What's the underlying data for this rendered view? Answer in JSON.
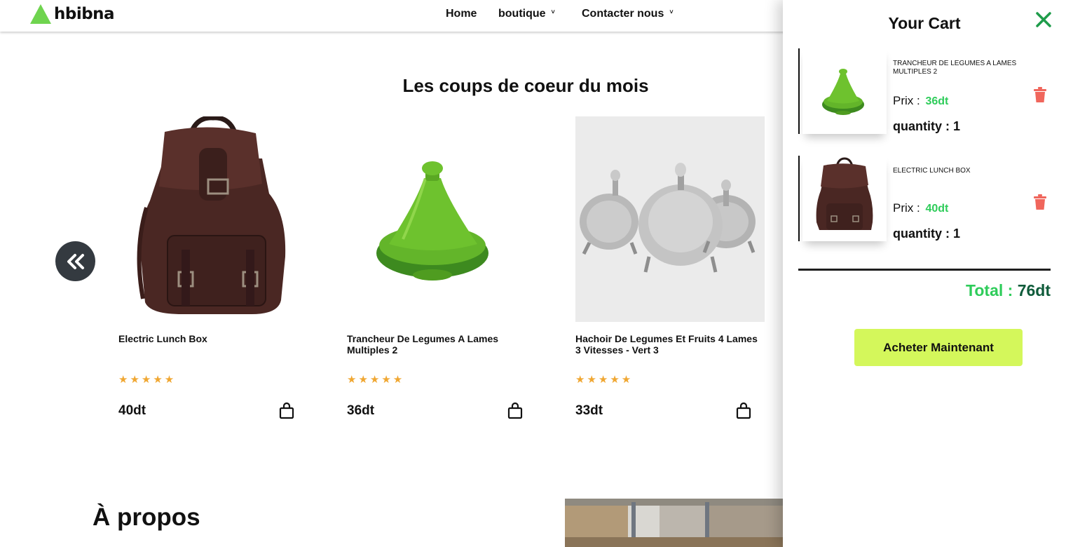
{
  "header": {
    "logo_text": "hbibna",
    "nav": [
      {
        "label": "Home"
      },
      {
        "label": "boutique"
      },
      {
        "label": "Contacter nous"
      }
    ]
  },
  "section": {
    "title": "Les coups de coeur du mois",
    "products": [
      {
        "name": "Electric Lunch Box",
        "price": "40dt",
        "rating": 5
      },
      {
        "name": "Trancheur De Legumes A Lames Multiples 2",
        "price": "36dt",
        "rating": 5
      },
      {
        "name": "Hachoir De Legumes Et Fruits 4 Lames 3 Vitesses - Vert 3",
        "price": "33dt",
        "rating": 5
      }
    ],
    "star_glyphs": "★★★★★"
  },
  "about": {
    "title": "À propos"
  },
  "cart": {
    "title": "Your Cart",
    "price_label": "Prix : ",
    "items": [
      {
        "name": "TRANCHEUR DE LEGUMES A LAMES MULTIPLES 2",
        "price": "36dt",
        "quantity": "quantity : 1"
      },
      {
        "name": "ELECTRIC LUNCH BOX",
        "price": "40dt",
        "quantity": "quantity : 1"
      }
    ],
    "total_label": "Total : ",
    "total_value": "76dt",
    "buy_label": "Acheter Maintenant"
  },
  "colors": {
    "logo_green": "#6fd44f",
    "price_green": "#2ecc5a",
    "total_dark_green": "#0f5b3a",
    "buy_button": "#d4f75b",
    "trash_red": "#f0665c",
    "stars": "#f0a732",
    "close_green": "#1e9c4a"
  },
  "icons": [
    "logo-triangle-icon",
    "chevron-down-icon",
    "double-chevron-left-icon",
    "shopping-bag-icon",
    "close-icon",
    "trash-icon"
  ]
}
